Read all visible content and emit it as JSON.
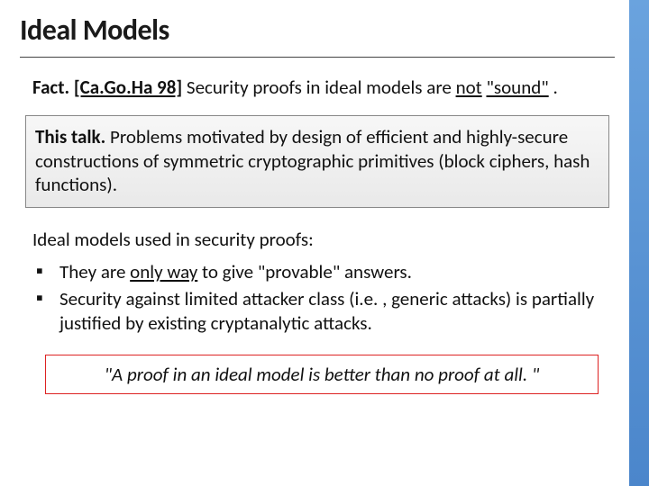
{
  "title": "Ideal Models",
  "fact": {
    "label": "Fact.",
    "cite": "[Ca.Go.Ha 98]",
    "tail1": " Security proofs in ideal models are ",
    "not": "not",
    "tail2": " ",
    "sound": "\"sound\"",
    "tail3": "."
  },
  "talk": {
    "label": "This talk.",
    "body": " Problems motivated by design of efficient and highly-secure constructions of symmetric cryptographic primitives (block ciphers, hash functions)."
  },
  "lead": "Ideal models used in security proofs:",
  "bullets": [
    {
      "pre": "They are ",
      "u": "only way",
      "post": " to give \"provable\" answers."
    },
    {
      "pre": "Security against limited attacker class (i.e. , generic attacks) is partially justified by existing cryptanalytic attacks.",
      "u": "",
      "post": ""
    }
  ],
  "quote": "\"A proof in an ideal model is better than no proof at all. \""
}
